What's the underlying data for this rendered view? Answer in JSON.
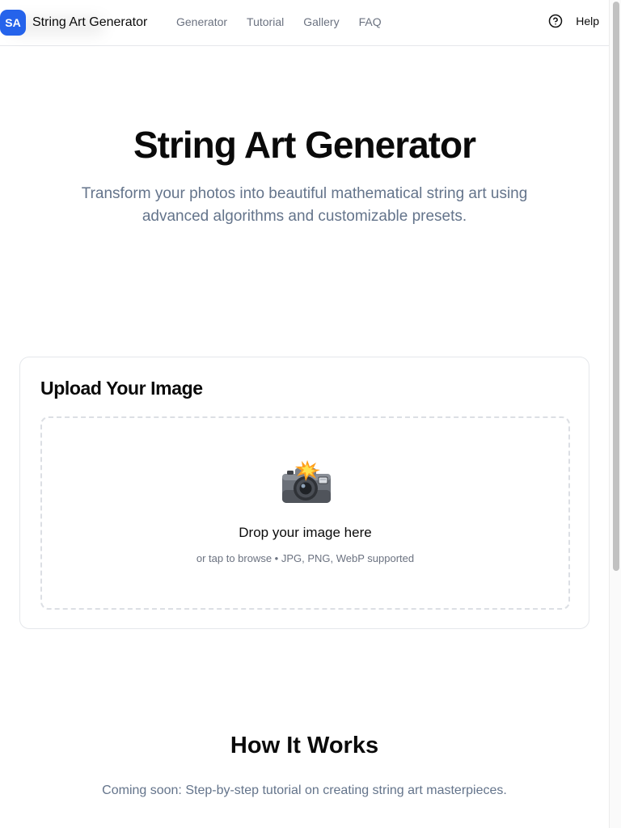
{
  "header": {
    "logo_initials": "SA",
    "brand_name": "String Art Generator",
    "nav": [
      {
        "label": "Generator"
      },
      {
        "label": "Tutorial"
      },
      {
        "label": "Gallery"
      },
      {
        "label": "FAQ"
      }
    ],
    "help_label": "Help",
    "help_icon": "question-circle-icon"
  },
  "hero": {
    "title": "String Art Generator",
    "subtitle": "Transform your photos into beautiful mathematical string art using advanced algorithms and customizable presets."
  },
  "upload": {
    "title": "Upload Your Image",
    "icon": "camera-flash-icon",
    "drop_title": "Drop your image here",
    "drop_hint": "or tap to browse • JPG, PNG, WebP supported"
  },
  "how_it_works": {
    "title": "How It Works",
    "subtitle": "Coming soon: Step-by-step tutorial on creating string art masterpieces."
  },
  "colors": {
    "accent": "#2563eb",
    "muted_text": "#64748b",
    "border": "#e5e7eb"
  }
}
